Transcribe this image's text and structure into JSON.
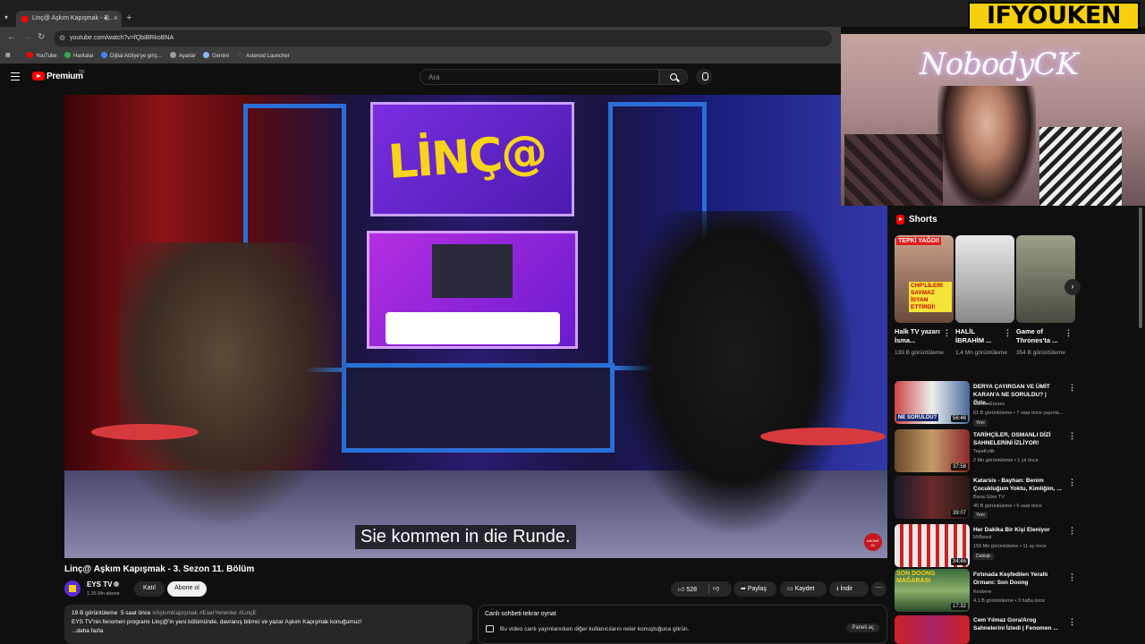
{
  "browser": {
    "tab_title": "Linç@ Aşkım Kapışmak - 3...",
    "url": "youtube.com/watch?v=fQbiBRkoBNA",
    "bookmarks": [
      "YouTube",
      "Haritalar",
      "Dijital Atölye'ye giriş...",
      "Ayarlar",
      "Gemini",
      "Asteroid Launcher"
    ]
  },
  "header": {
    "logo_text": "Premium",
    "region": "TR",
    "search_placeholder": "Ara"
  },
  "video": {
    "subtitle": "Sie kommen in die Runde.",
    "title": "Linç@ Aşkım Kapışmak - 3. Sezon 11. Bölüm",
    "channel": "EYS TV",
    "subscribers": "1,35 Mn abone",
    "join_label": "Katıl",
    "subscribe_label": "Abone ol",
    "likes": "528",
    "share_label": "Paylaş",
    "save_label": "Kaydet",
    "download_label": "İndir",
    "more_label": "⋯",
    "stream_logo_text": "ABONE OL"
  },
  "description": {
    "views": "19 B görüntüleme",
    "time": "5 saat önce",
    "tags": "#AşkımKapışmak #EserYenenler #LinçE",
    "text": "EYS TV'nin fenomen programı Linç@'in yeni bölümünde, davranış bilimci ve yazar Aşkım Kapışmak konuğumuz!",
    "more": "...daha fazla"
  },
  "chat": {
    "title": "Canlı sohbeti tekrar oynat",
    "text": "Bu video canlı yayınlanırken diğer kullanıcıların neler konuştuğuna görün.",
    "button": "Paneli aç"
  },
  "overlay": {
    "neon_text": "NobodyCK",
    "brand": "IFYOUKEN"
  },
  "shorts": {
    "heading": "Shorts",
    "items": [
      {
        "title": "Halk TV yazarı İsma...",
        "views": "139 B görüntüleme",
        "overlay": "TEPKİ YAĞDI!",
        "overlay2": "CHP'LİLERİ SAYMAZ İSYAN ETTİRDİ!"
      },
      {
        "title": "HALİL İBRAHİM ...",
        "views": "1,4 Mn görüntüleme",
        "overlay": "",
        "overlay2": ""
      },
      {
        "title": "Game of Thrones'ta ...",
        "views": "354 B görüntüleme",
        "overlay": "",
        "overlay2": ""
      }
    ]
  },
  "recommended": [
    {
      "title": "DERYA ÇAYIRGAN VE ÜMİT KARAN'A NE SORULDU? | Özle...",
      "channel": "Özlem Gürses",
      "meta": "61 B görüntüleme • 7 saat önce yayınla...",
      "badge": "Yeni",
      "duration": "56:46",
      "thumb_text": "NE SORULDU?"
    },
    {
      "title": "TARİHÇİLER, OSMANLI DİZİ SAHNELERİNİ İZLİYOR!",
      "channel": "TepeKolik",
      "meta": "2 Mn görüntüleme • 1 yıl önce",
      "badge": "",
      "duration": "37:58",
      "thumb_text": ""
    },
    {
      "title": "Katarsis - Bayhan: Benim Çocukluğum Yoktu, Kimliğim, ...",
      "channel": "Bana Göre TV",
      "meta": "45 B görüntüleme • 6 saat önce",
      "badge": "Yeni",
      "duration": "39:07",
      "thumb_text": ""
    },
    {
      "title": "Her Dakika Bir Kişi Eleniyor",
      "channel": "MrBeast",
      "meta": "156 Mn görüntüleme • 11 ay önce",
      "badge": "Dublajlı",
      "duration": "34:46",
      "thumb_text": ""
    },
    {
      "title": "Fırtınada Keşfedilen Yeraltı Ormanı: Son Doong",
      "channel": "Kesbere",
      "meta": "4,1 B görüntüleme • 3 hafta önce",
      "badge": "",
      "duration": "17:32",
      "thumb_text": "SON DOONG MAĞARASI"
    },
    {
      "title": "Cem Yılmaz Gora/Arog Sahnelerini İzledi | Fenomen ...",
      "channel": "",
      "meta": "",
      "badge": "",
      "duration": "",
      "thumb_text": ""
    }
  ]
}
